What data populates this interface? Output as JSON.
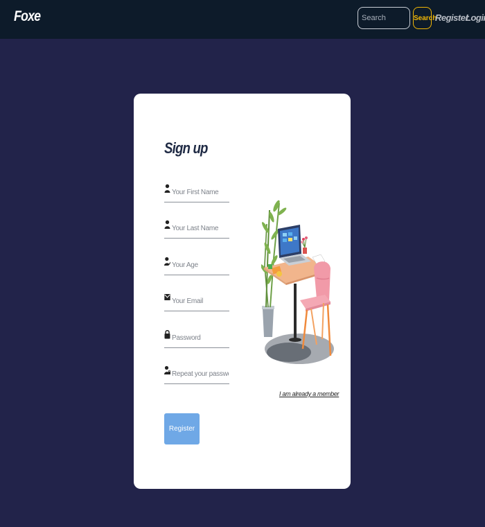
{
  "navbar": {
    "brand": "Foxe",
    "search_placeholder": "Search",
    "search_button_label": "Search",
    "register_link": "Register",
    "login_link": "Login"
  },
  "signup": {
    "title": "Sign up",
    "fields": [
      {
        "placeholder": "Your First Name",
        "icon": "user-icon"
      },
      {
        "placeholder": "Your Last Name",
        "icon": "user-icon"
      },
      {
        "placeholder": "Your Age",
        "icon": "user-edit-icon"
      },
      {
        "placeholder": "Your Email",
        "icon": "envelope-icon"
      },
      {
        "placeholder": "Password",
        "icon": "lock-icon"
      },
      {
        "placeholder": "Repeat your password",
        "icon": "user-lock-icon"
      }
    ],
    "register_button_label": "Register",
    "member_link": "I am already a member"
  },
  "colors": {
    "page_background": "#22234a",
    "navbar_background": "#0d1b2a",
    "search_accent": "#f2b705",
    "register_button": "#6fa8e6",
    "card_background": "#ffffff"
  }
}
